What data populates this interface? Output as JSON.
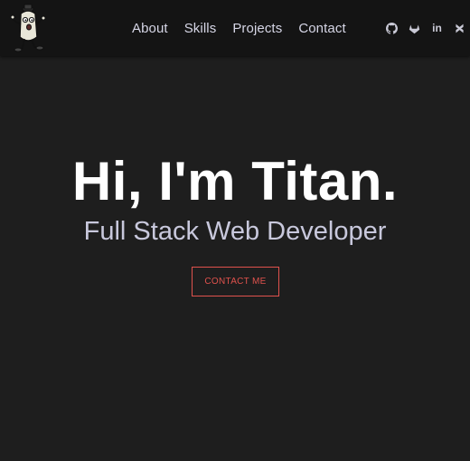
{
  "nav": {
    "links": [
      "About",
      "Skills",
      "Projects",
      "Contact"
    ]
  },
  "social": {
    "icons": [
      "github-icon",
      "gitlab-icon",
      "linkedin-icon",
      "codepen-icon"
    ],
    "linkedin_text": "in"
  },
  "hero": {
    "title": "Hi, I'm Titan.",
    "subtitle": "Full Stack Web Developer",
    "cta_label": "CONTACT ME"
  },
  "colors": {
    "background": "#1e1e1e",
    "navbar": "#141414",
    "nav_text": "#d6d6e6",
    "accent": "#e0524d",
    "subtitle": "#c8c8dc"
  }
}
